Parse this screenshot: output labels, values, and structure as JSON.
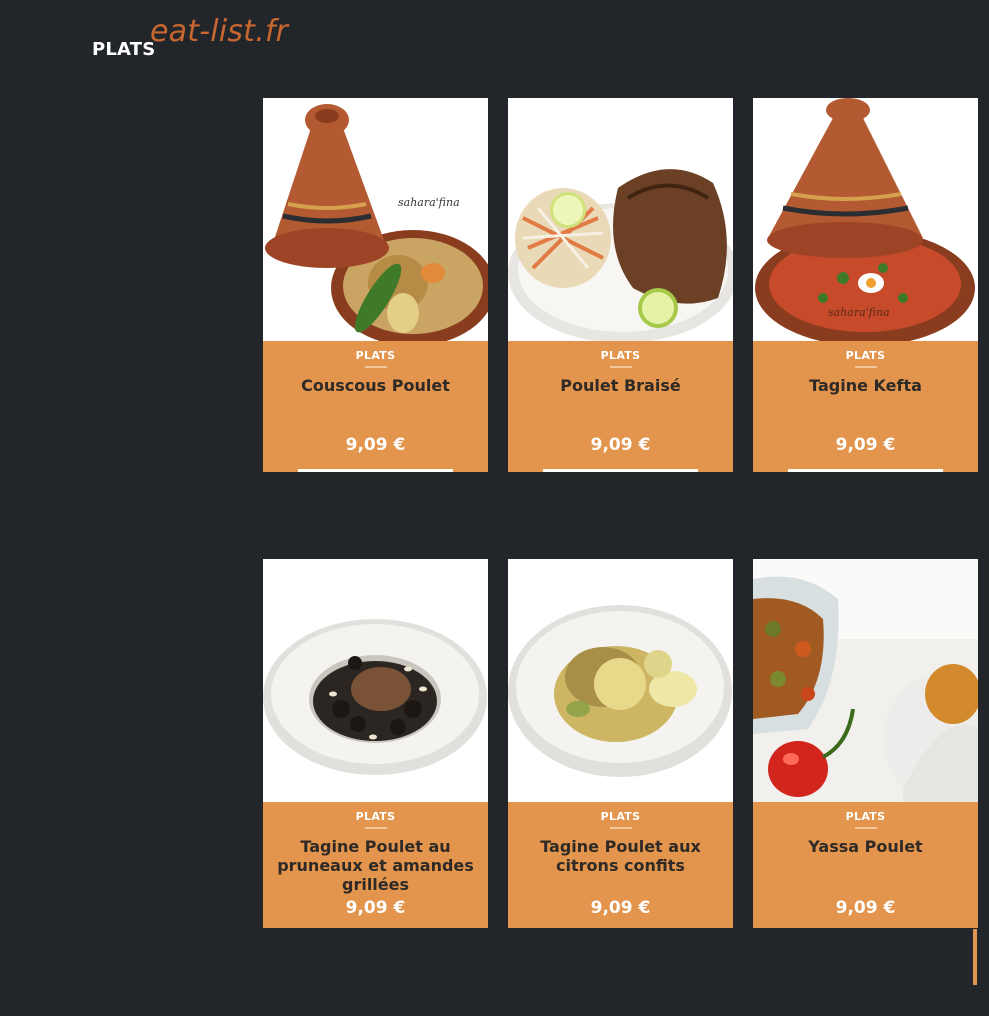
{
  "header": {
    "category_title": "PLATS",
    "watermark": "eat-list.fr"
  },
  "colors": {
    "background": "#22252a",
    "card_accent": "#e3954d",
    "watermark": "#c8672f"
  },
  "products": [
    {
      "category": "PLATS",
      "name": "Couscous Poulet",
      "price": "9,09 €",
      "image_icon": "tagine-couscous-photo",
      "photo_caption": "sahara'fina"
    },
    {
      "category": "PLATS",
      "name": "Poulet Braisé",
      "price": "9,09 €",
      "image_icon": "braised-chicken-plate-photo"
    },
    {
      "category": "PLATS",
      "name": "Tagine Kefta",
      "price": "9,09 €",
      "image_icon": "tagine-kefta-photo",
      "photo_caption": "sahara'fina"
    },
    {
      "category": "PLATS",
      "name": "Tagine Poulet au pruneaux et amandes grillées",
      "price": "9,09 €",
      "image_icon": "prunes-almond-tagine-photo"
    },
    {
      "category": "PLATS",
      "name": "Tagine Poulet aux citrons confits",
      "price": "9,09 €",
      "image_icon": "preserved-lemon-tagine-photo"
    },
    {
      "category": "PLATS",
      "name": "Yassa Poulet",
      "price": "9,09 €",
      "image_icon": "yassa-chicken-photo"
    }
  ]
}
